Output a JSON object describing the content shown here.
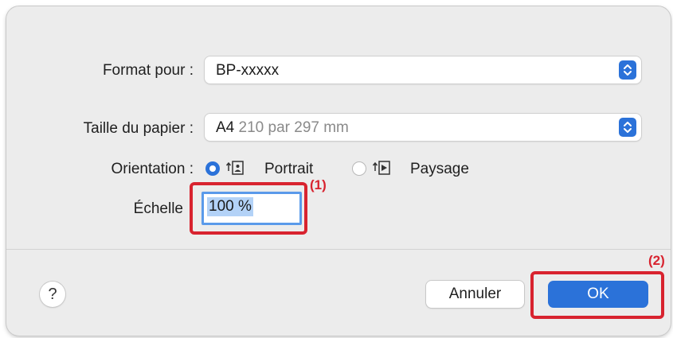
{
  "format_for": {
    "label": "Format pour :",
    "value": "BP-xxxxx",
    "stepper_icon": "popup-stepper-icon"
  },
  "paper_size": {
    "label": "Taille du papier :",
    "value": "A4",
    "detail": "210 par 297 mm",
    "stepper_icon": "popup-stepper-icon"
  },
  "orientation": {
    "label": "Orientation :",
    "options": [
      {
        "label": "Portrait",
        "selected": true,
        "icon": "portrait-orientation-icon"
      },
      {
        "label": "Paysage",
        "selected": false,
        "icon": "landscape-orientation-icon"
      }
    ]
  },
  "scale": {
    "label": "Échelle",
    "value": "100 %"
  },
  "callouts": {
    "one": "(1)",
    "two": "(2)"
  },
  "buttons": {
    "help": "?",
    "cancel": "Annuler",
    "ok": "OK"
  },
  "colors": {
    "accent": "#2b72d9",
    "highlight_box": "#d8232f",
    "dialog_bg": "#ececec"
  }
}
